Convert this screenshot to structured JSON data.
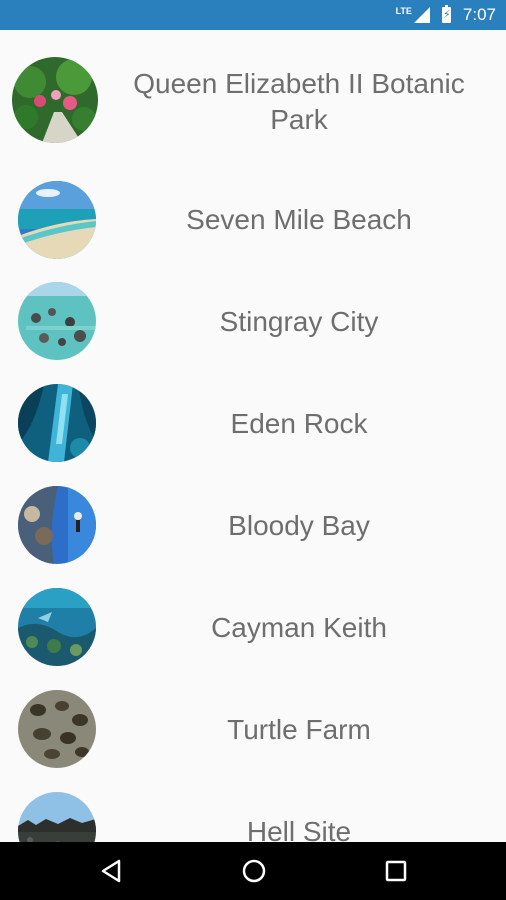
{
  "status_bar": {
    "network": "LTE",
    "time": "7:07",
    "icons": [
      "lte-signal-icon",
      "battery-charging-icon"
    ]
  },
  "places": [
    {
      "name": "Queen Elizabeth II Botanic Park",
      "image": "botanic-park-photo"
    },
    {
      "name": "Seven Mile Beach",
      "image": "beach-photo"
    },
    {
      "name": "Stingray City",
      "image": "stingray-city-photo"
    },
    {
      "name": "Eden Rock",
      "image": "eden-rock-underwater-photo"
    },
    {
      "name": "Bloody Bay",
      "image": "bloody-bay-diver-photo"
    },
    {
      "name": "Cayman Keith",
      "image": "cayman-keith-reef-photo"
    },
    {
      "name": "Turtle Farm",
      "image": "turtle-farm-photo"
    },
    {
      "name": "Hell Site",
      "image": "hell-site-rocks-photo"
    }
  ],
  "nav_bar": {
    "icons": [
      "back-triangle-icon",
      "home-circle-icon",
      "recents-square-icon"
    ]
  },
  "colors": {
    "status_bar": "#2a7fbd",
    "text": "#6e6e6e",
    "background": "#fafafa",
    "nav_bar": "#000000"
  }
}
